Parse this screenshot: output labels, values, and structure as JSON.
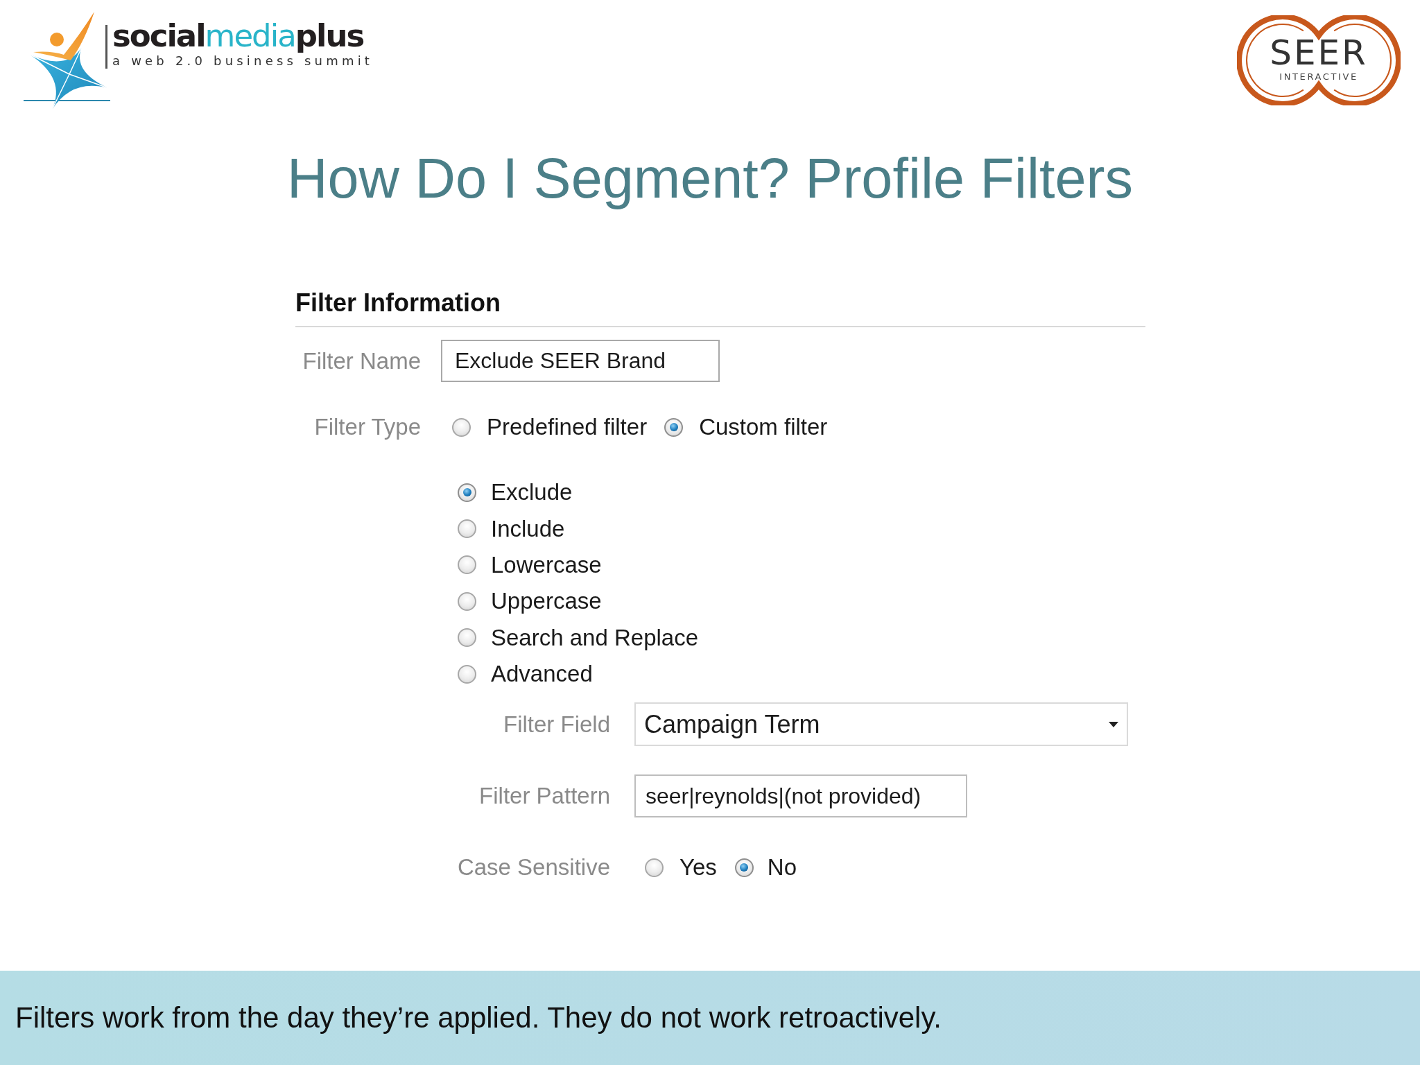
{
  "header": {
    "logo_left": {
      "wordmark": [
        {
          "text": "social",
          "color": "#231f20"
        },
        {
          "text": "media",
          "color": "#29b4c9"
        },
        {
          "text": "plus",
          "color": "#231f20"
        }
      ],
      "tagline": "a web 2.0 business summit"
    },
    "logo_right": {
      "name": "SEER",
      "subtitle": "INTERACTIVE"
    }
  },
  "title": "How Do I Segment? Profile Filters",
  "form": {
    "heading": "Filter Information",
    "filter_name": {
      "label": "Filter Name",
      "value": "Exclude SEER Brand"
    },
    "filter_type": {
      "label": "Filter Type",
      "options": [
        {
          "label": "Predefined filter",
          "selected": false
        },
        {
          "label": "Custom filter",
          "selected": true
        }
      ]
    },
    "custom_filter_types": [
      {
        "label": "Exclude",
        "selected": true
      },
      {
        "label": "Include",
        "selected": false
      },
      {
        "label": "Lowercase",
        "selected": false
      },
      {
        "label": "Uppercase",
        "selected": false
      },
      {
        "label": "Search and Replace",
        "selected": false
      },
      {
        "label": "Advanced",
        "selected": false
      }
    ],
    "filter_field": {
      "label": "Filter Field",
      "value": "Campaign Term"
    },
    "filter_pattern": {
      "label": "Filter Pattern",
      "value": "seer|reynolds|(not provided)"
    },
    "case_sensitive": {
      "label": "Case Sensitive",
      "options": [
        {
          "label": "Yes",
          "selected": false
        },
        {
          "label": "No",
          "selected": true
        }
      ]
    }
  },
  "footer_note": "Filters work from the day they’re applied. They do not work retroactively."
}
